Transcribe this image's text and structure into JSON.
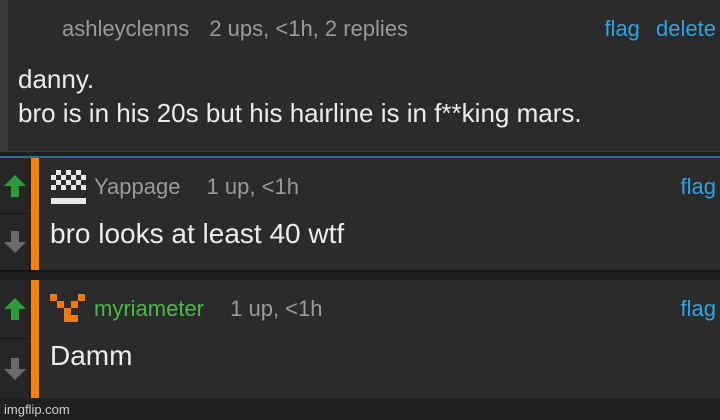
{
  "parent": {
    "username": "ashleyclenns",
    "stats": "2 ups, <1h, 2 replies",
    "flag_label": "flag",
    "delete_label": "delete",
    "line1": "danny.",
    "line2": "bro is in his 20s but his hairline is in f**king mars."
  },
  "replies": [
    {
      "username": "Yappage",
      "stats": "1 up, <1h",
      "flag_label": "flag",
      "text": "bro looks at least 40 wtf"
    },
    {
      "username": "myriameter",
      "stats": "1 up, <1h",
      "flag_label": "flag",
      "text": "Damm"
    }
  ],
  "colors": {
    "accent_bar": "#f5830a",
    "link": "#2ea3e6",
    "upvote": "#2e9b3a",
    "username_green": "#4cb84c"
  },
  "watermark": "imgflip.com"
}
